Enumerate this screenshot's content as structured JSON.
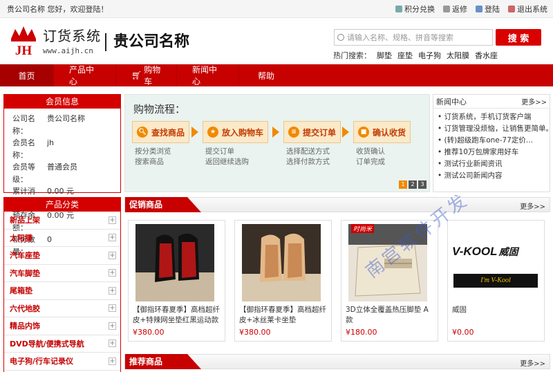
{
  "topbar": {
    "greeting": "贵公司名称 您好，欢迎登陆！",
    "links": [
      "积分兑换",
      "返修",
      "登陆",
      "退出系统"
    ]
  },
  "logo": {
    "cn": "订货系统",
    "url": "www.aijh.cn",
    "mark": "JH"
  },
  "company": "贵公司名称",
  "search": {
    "placeholder": "请输入名称、规格、拼音等搜索",
    "button": "搜 索"
  },
  "hot": {
    "label": "热门搜索：",
    "items": [
      "脚垫",
      "座垫",
      "电子狗",
      "太阳膜",
      "香水座"
    ]
  },
  "nav": [
    "首页",
    "产品中心",
    "购物车",
    "新闻中心",
    "帮助"
  ],
  "member": {
    "title": "会员信息",
    "rows": [
      {
        "label": "公司名称：",
        "value": "贵公司名称"
      },
      {
        "label": "会员名称：",
        "value": "jh"
      },
      {
        "label": "会员等级：",
        "value": "普通会员"
      },
      {
        "label": "累计消费：",
        "value": "0.00 元"
      },
      {
        "label": "预存余额：",
        "value": "0.00 元"
      },
      {
        "label": "积分数量：",
        "value": "0"
      }
    ]
  },
  "process": {
    "title": "购物流程：",
    "steps": [
      {
        "label": "查找商品",
        "subs": [
          "按分类浏览",
          "搜索商品"
        ]
      },
      {
        "label": "放入购物车",
        "subs": [
          "提交订单",
          "返回继续选购"
        ]
      },
      {
        "label": "提交订单",
        "subs": [
          "选择配送方式",
          "选择付款方式"
        ]
      },
      {
        "label": "确认收货",
        "subs": [
          "收货确认",
          "订单完成"
        ]
      }
    ],
    "pages": [
      "1",
      "2",
      "3"
    ]
  },
  "news": {
    "title": "新闻中心",
    "more": "更多>>",
    "items": [
      "订货系统，手机订货客户端",
      "订货管理没烦恼，让销售更简单。",
      "(转)超级跑车one-77定价...",
      "推荐10万包牌家用好车",
      "测试行业新闻资讯",
      "测试公司新闻内容"
    ]
  },
  "categories": {
    "title": "产品分类",
    "items": [
      "新品上架",
      "太阳膜",
      "汽车座垫",
      "汽车脚垫",
      "尾箱垫",
      "六代地胶",
      "精品内饰",
      "DVD导航/便携式导航",
      "电子狗/行车记录仪"
    ]
  },
  "promo": {
    "title": "促销商品",
    "more": "更多>>"
  },
  "recommend": {
    "title": "推荐商品",
    "more": "更多>>"
  },
  "products": [
    {
      "name": "【御指环春夏季】高档超纤皮+特辣网坐垫红黑运动款",
      "price": "¥380.00"
    },
    {
      "name": "【御指环春夏季】高档超纤皮+冰丝莱卡坐垫",
      "price": "¥380.00"
    },
    {
      "name": "3D立体全覆盖热压脚垫 A款",
      "price": "¥180.00",
      "tag": "时尚米"
    },
    {
      "name": "威固",
      "price": "¥0.00",
      "brand": "V-KOOL",
      "brand_cn": "威固",
      "slogan": "I'm V-Kool"
    }
  ],
  "watermark": "南宫软件开发",
  "colors": {
    "brand_red": "#c70000",
    "price_red": "#cc0000",
    "accent_orange": "#f08a00"
  }
}
